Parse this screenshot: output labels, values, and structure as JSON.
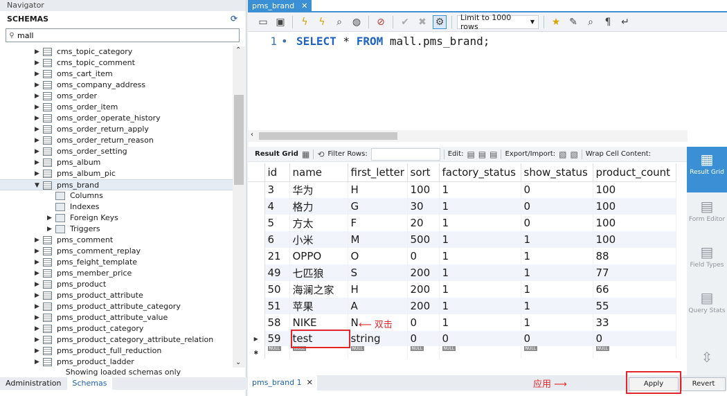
{
  "navigator": {
    "title": "Navigator",
    "schemas_heading": "SCHEMAS",
    "filter_value": "mall",
    "tree": [
      {
        "label": "cms_topic_category",
        "kind": "table"
      },
      {
        "label": "cms_topic_comment",
        "kind": "table"
      },
      {
        "label": "oms_cart_item",
        "kind": "table"
      },
      {
        "label": "oms_company_address",
        "kind": "table"
      },
      {
        "label": "oms_order",
        "kind": "table"
      },
      {
        "label": "oms_order_item",
        "kind": "table"
      },
      {
        "label": "oms_order_operate_history",
        "kind": "table"
      },
      {
        "label": "oms_order_return_apply",
        "kind": "table"
      },
      {
        "label": "oms_order_return_reason",
        "kind": "table"
      },
      {
        "label": "oms_order_setting",
        "kind": "table"
      },
      {
        "label": "pms_album",
        "kind": "table"
      },
      {
        "label": "pms_album_pic",
        "kind": "table"
      },
      {
        "label": "pms_brand",
        "kind": "table-open"
      },
      {
        "label": "Columns",
        "kind": "sub"
      },
      {
        "label": "Indexes",
        "kind": "sub"
      },
      {
        "label": "Foreign Keys",
        "kind": "sub-arrow"
      },
      {
        "label": "Triggers",
        "kind": "sub-arrow"
      },
      {
        "label": "pms_comment",
        "kind": "table"
      },
      {
        "label": "pms_comment_replay",
        "kind": "table"
      },
      {
        "label": "pms_feight_template",
        "kind": "table"
      },
      {
        "label": "pms_member_price",
        "kind": "table"
      },
      {
        "label": "pms_product",
        "kind": "table"
      },
      {
        "label": "pms_product_attribute",
        "kind": "table"
      },
      {
        "label": "pms_product_attribute_category",
        "kind": "table"
      },
      {
        "label": "pms_product_attribute_value",
        "kind": "table"
      },
      {
        "label": "pms_product_category",
        "kind": "table"
      },
      {
        "label": "pms_product_category_attribute_relation",
        "kind": "table"
      },
      {
        "label": "pms_product_full_reduction",
        "kind": "table"
      },
      {
        "label": "pms_product_ladder",
        "kind": "table"
      }
    ],
    "status": "Showing loaded schemas only",
    "tab_administration": "Administration",
    "tab_schemas": "Schemas"
  },
  "editor": {
    "tab_label": "pms_brand",
    "limit_label": "Limit to 1000 rows",
    "line_number": "1",
    "sql": {
      "kw1": "SELECT",
      "star": " * ",
      "kw2": "FROM",
      "rest": " mall.pms_brand;"
    }
  },
  "result_toolbar": {
    "result_grid": "Result Grid",
    "filter_rows": "Filter Rows:",
    "edit": "Edit:",
    "export_import": "Export/Import:",
    "wrap": "Wrap Cell Content:"
  },
  "grid": {
    "columns": [
      "id",
      "name",
      "first_letter",
      "sort",
      "factory_status",
      "show_status",
      "product_count"
    ],
    "rows": [
      [
        "3",
        "华为",
        "H",
        "100",
        "1",
        "0",
        "100"
      ],
      [
        "4",
        "格力",
        "G",
        "30",
        "1",
        "0",
        "100"
      ],
      [
        "5",
        "方太",
        "F",
        "20",
        "1",
        "0",
        "100"
      ],
      [
        "6",
        "小米",
        "M",
        "500",
        "1",
        "1",
        "100"
      ],
      [
        "21",
        "OPPO",
        "O",
        "0",
        "1",
        "1",
        "88"
      ],
      [
        "49",
        "七匹狼",
        "S",
        "200",
        "1",
        "1",
        "77"
      ],
      [
        "50",
        "海澜之家",
        "H",
        "200",
        "1",
        "1",
        "66"
      ],
      [
        "51",
        "苹果",
        "A",
        "200",
        "1",
        "1",
        "55"
      ],
      [
        "58",
        "NIKE",
        "N",
        "0",
        "1",
        "1",
        "33"
      ]
    ],
    "edit_row": [
      "59",
      "test",
      "string",
      "0",
      "0",
      "0",
      "0"
    ],
    "null_label": "NULL"
  },
  "annotations": {
    "double_click": "双击",
    "apply": "应用"
  },
  "side_panel": {
    "result_grid": "Result Grid",
    "form_editor": "Form Editor",
    "field_types": "Field Types",
    "query_stats": "Query Stats"
  },
  "bottom": {
    "result_tab": "pms_brand 1",
    "apply_button": "Apply",
    "revert_button": "Revert"
  },
  "colors": {
    "accent": "#3a8fd5",
    "annotation": "#e0262a"
  }
}
